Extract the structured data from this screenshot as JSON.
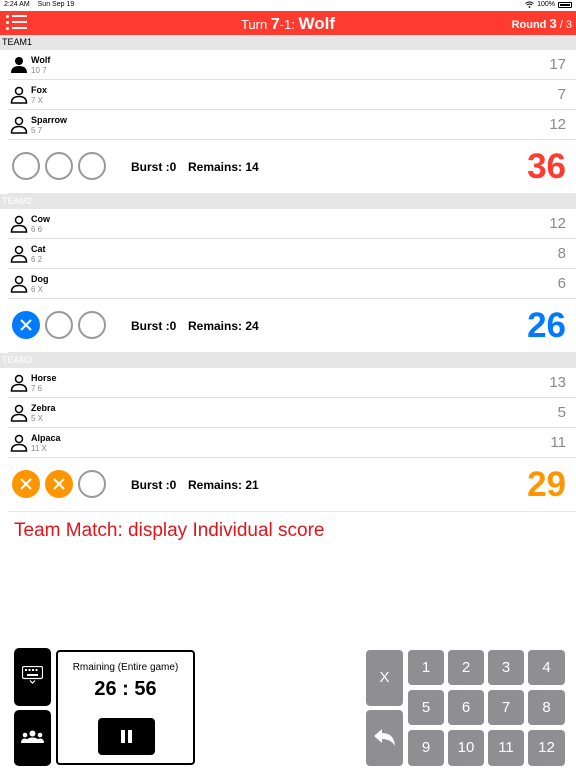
{
  "status_bar": {
    "time": "2:24 AM",
    "date": "Sun Sep 19",
    "battery": "100%"
  },
  "header": {
    "turn_prefix": "Turn ",
    "turn_number": "7",
    "turn_suffix": "-1: ",
    "current_player": "Wolf",
    "round_label": "Round ",
    "round_current": "3",
    "round_sep": " / ",
    "round_total": "3",
    "menu_icon": "list-icon",
    "color": "#ff3b30"
  },
  "teams": [
    {
      "name": "TEAM1",
      "players": [
        {
          "name": "Wolf",
          "darts": "10 7",
          "score": "17",
          "active": true
        },
        {
          "name": "Fox",
          "darts": "7 X",
          "score": "7",
          "active": false
        },
        {
          "name": "Sparrow",
          "darts": "5 7",
          "score": "12",
          "active": false
        }
      ],
      "misses": [
        false,
        false,
        false
      ],
      "burst": "Burst :0",
      "remains": "Remains: 14",
      "total": "36",
      "color": "#ff3b30"
    },
    {
      "name": "TEAM2",
      "players": [
        {
          "name": "Cow",
          "darts": "6 6",
          "score": "12",
          "active": false
        },
        {
          "name": "Cat",
          "darts": "6 2",
          "score": "8",
          "active": false
        },
        {
          "name": "Dog",
          "darts": "6 X",
          "score": "6",
          "active": false
        }
      ],
      "misses": [
        true,
        false,
        false
      ],
      "burst": "Burst :0",
      "remains": "Remains: 24",
      "total": "26",
      "color": "#007aff"
    },
    {
      "name": "TEAM3",
      "players": [
        {
          "name": "Horse",
          "darts": "7 6",
          "score": "13",
          "active": false
        },
        {
          "name": "Zebra",
          "darts": "5 X",
          "score": "5",
          "active": false
        },
        {
          "name": "Alpaca",
          "darts": "11 X",
          "score": "11",
          "active": false
        }
      ],
      "misses": [
        true,
        true,
        false
      ],
      "burst": "Burst :0",
      "remains": "Remains: 21",
      "total": "29",
      "color": "#ff9500"
    }
  ],
  "notice": "Team Match: display Individual score",
  "timer": {
    "label": "Rmaining  (Entire game)",
    "value": "26 : 56"
  },
  "keypad": {
    "miss_label": "X",
    "back_icon": "undo-arrow-icon",
    "numbers": [
      "1",
      "2",
      "3",
      "4",
      "5",
      "6",
      "7",
      "8",
      "9",
      "10",
      "11",
      "12"
    ]
  },
  "side_buttons": {
    "keyboard_icon": "keyboard-icon",
    "team_icon": "group-icon"
  }
}
